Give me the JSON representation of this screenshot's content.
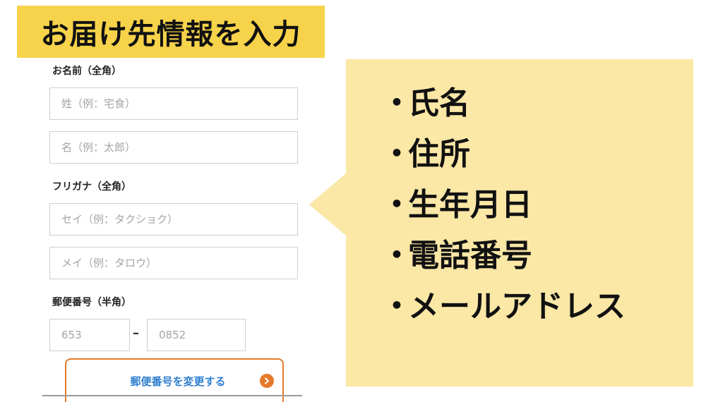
{
  "title": "お届け先情報を入力",
  "form": {
    "name_section_label": "お名前（全角）",
    "last_name_placeholder": "姓（例：宅食）",
    "first_name_placeholder": "名（例：太郎）",
    "kana_section_label": "フリガナ（全角）",
    "last_kana_placeholder": "セイ（例：タクショク）",
    "first_kana_placeholder": "メイ（例：タロウ）",
    "postal_section_label": "郵便番号（半角）",
    "postal_first_placeholder": "653",
    "postal_dash": "–",
    "postal_second_placeholder": "0852",
    "postal_button_label": "郵便番号を変更する"
  },
  "callout": {
    "bullet": "・",
    "items": [
      "氏名",
      "住所",
      "生年月日",
      "電話番号",
      "メールアドレス"
    ]
  },
  "colors": {
    "banner": "#f6d34a",
    "callout_bg": "#fbe7a6",
    "button_border": "#e57a2c",
    "button_text": "#2f7fcf",
    "input_border": "#cfcfcf"
  }
}
